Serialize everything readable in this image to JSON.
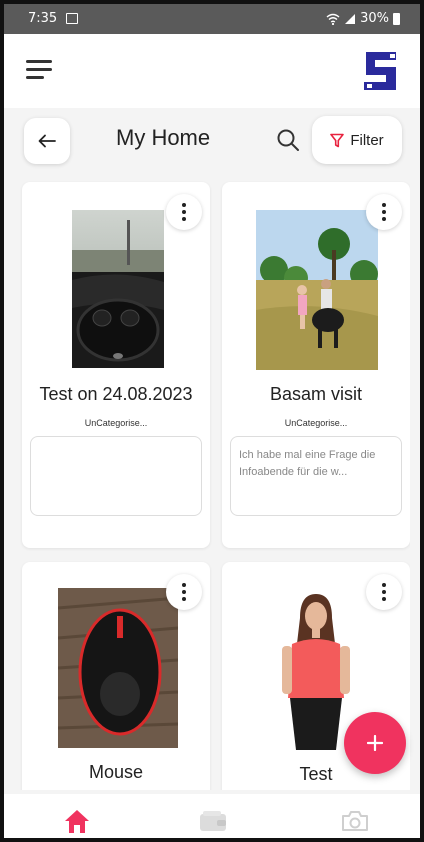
{
  "status_bar": {
    "time": "7:35",
    "battery": "30%"
  },
  "header": {
    "title": "My Home",
    "filter_label": "Filter"
  },
  "items": [
    {
      "name": "Test on 24.08.2023",
      "category": "UnCategorise...",
      "note": ""
    },
    {
      "name": "Basam visit",
      "category": "UnCategorise...",
      "note": "Ich habe mal eine Frage die Infoabende für die w..."
    },
    {
      "name": "Mouse",
      "category": "",
      "note": ""
    },
    {
      "name": "Test",
      "category": "",
      "note": ""
    }
  ],
  "colors": {
    "accent": "#f0335f",
    "text": "#222222",
    "background": "#f4f4f4"
  },
  "icons": {
    "menu": "hamburger-icon",
    "logo": "app-logo",
    "back": "arrow-left-icon",
    "search": "search-icon",
    "filter": "filter-icon",
    "more": "more-vertical-icon",
    "add": "plus-icon",
    "nav": [
      "home-icon",
      "wallet-icon",
      "camera-icon"
    ]
  }
}
